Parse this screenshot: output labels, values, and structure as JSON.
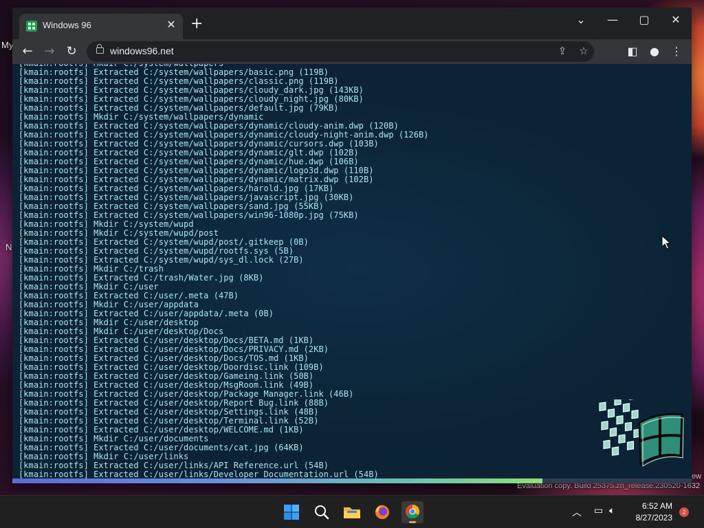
{
  "desktop": {
    "label_my": "My",
    "label_n": "N",
    "watermark": "Evaluation copy. Build 25375.zn_release.230520-1632",
    "watermark_right": "ew"
  },
  "browser": {
    "tab_title": "Windows 96",
    "url": "windows96.net"
  },
  "terminal": {
    "lines": [
      "[kmain:rootfs] Mkdir C:/system/wallpapers",
      "[kmain:rootfs] Extracted C:/system/wallpapers/basic.png (119B)",
      "[kmain:rootfs] Extracted C:/system/wallpapers/classic.png (119B)",
      "[kmain:rootfs] Extracted C:/system/wallpapers/cloudy_dark.jpg (143KB)",
      "[kmain:rootfs] Extracted C:/system/wallpapers/cloudy_night.jpg (80KB)",
      "[kmain:rootfs] Extracted C:/system/wallpapers/default.jpg (79KB)",
      "[kmain:rootfs] Mkdir C:/system/wallpapers/dynamic",
      "[kmain:rootfs] Extracted C:/system/wallpapers/dynamic/cloudy-anim.dwp (120B)",
      "[kmain:rootfs] Extracted C:/system/wallpapers/dynamic/cloudy-night-anim.dwp (126B)",
      "[kmain:rootfs] Extracted C:/system/wallpapers/dynamic/cursors.dwp (103B)",
      "[kmain:rootfs] Extracted C:/system/wallpapers/dynamic/glt.dwp (102B)",
      "[kmain:rootfs] Extracted C:/system/wallpapers/dynamic/hue.dwp (106B)",
      "[kmain:rootfs] Extracted C:/system/wallpapers/dynamic/logo3d.dwp (110B)",
      "[kmain:rootfs] Extracted C:/system/wallpapers/dynamic/matrix.dwp (102B)",
      "[kmain:rootfs] Extracted C:/system/wallpapers/harold.jpg (17KB)",
      "[kmain:rootfs] Extracted C:/system/wallpapers/javascript.jpg (30KB)",
      "[kmain:rootfs] Extracted C:/system/wallpapers/sand.jpg (55KB)",
      "[kmain:rootfs] Extracted C:/system/wallpapers/win96-1080p.jpg (75KB)",
      "[kmain:rootfs] Mkdir C:/system/wupd",
      "[kmain:rootfs] Mkdir C:/system/wupd/post",
      "[kmain:rootfs] Extracted C:/system/wupd/post/.gitkeep (0B)",
      "[kmain:rootfs] Extracted C:/system/wupd/rootfs.sys (5B)",
      "[kmain:rootfs] Extracted C:/system/wupd/sys_dl.lock (27B)",
      "[kmain:rootfs] Mkdir C:/trash",
      "[kmain:rootfs] Extracted C:/trash/Water.jpg (8KB)",
      "[kmain:rootfs] Mkdir C:/user",
      "[kmain:rootfs] Extracted C:/user/.meta (47B)",
      "[kmain:rootfs] Mkdir C:/user/appdata",
      "[kmain:rootfs] Extracted C:/user/appdata/.meta (0B)",
      "[kmain:rootfs] Mkdir C:/user/desktop",
      "[kmain:rootfs] Mkdir C:/user/desktop/Docs",
      "[kmain:rootfs] Extracted C:/user/desktop/Docs/BETA.md (1KB)",
      "[kmain:rootfs] Extracted C:/user/desktop/Docs/PRIVACY.md (2KB)",
      "[kmain:rootfs] Extracted C:/user/desktop/Docs/TOS.md (1KB)",
      "[kmain:rootfs] Extracted C:/user/desktop/Doordisc.link (109B)",
      "[kmain:rootfs] Extracted C:/user/desktop/Gameing.link (50B)",
      "[kmain:rootfs] Extracted C:/user/desktop/MsgRoom.link (49B)",
      "[kmain:rootfs] Extracted C:/user/desktop/Package Manager.link (46B)",
      "[kmain:rootfs] Extracted C:/user/desktop/Report Bug.link (88B)",
      "[kmain:rootfs] Extracted C:/user/desktop/Settings.link (48B)",
      "[kmain:rootfs] Extracted C:/user/desktop/Terminal.link (52B)",
      "[kmain:rootfs] Extracted C:/user/desktop/WELCOME.md (1KB)",
      "[kmain:rootfs] Mkdir C:/user/documents",
      "[kmain:rootfs] Extracted C:/user/documents/cat.jpg (64KB)",
      "[kmain:rootfs] Mkdir C:/user/links",
      "[kmain:rootfs] Extracted C:/user/links/API Reference.url (54B)",
      "[kmain:rootfs] Extracted C:/user/links/Developer Documentation.url (54B)"
    ],
    "progress": 0.78,
    "text_color": "#a9e6f2",
    "background_color": "#0b2334"
  },
  "taskbar": {
    "apps": [
      {
        "name": "start-button",
        "icon": "windows-logo-icon"
      },
      {
        "name": "search-button",
        "icon": "search-icon"
      },
      {
        "name": "file-explorer",
        "icon": "folder-icon"
      },
      {
        "name": "firefox",
        "icon": "firefox-icon"
      },
      {
        "name": "chrome",
        "icon": "chrome-icon",
        "active": true
      }
    ],
    "time": "6:52 AM",
    "date": "8/27/2023",
    "notification_count": "2"
  }
}
